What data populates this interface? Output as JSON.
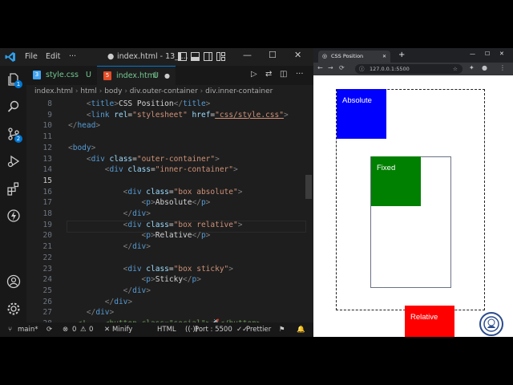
{
  "window": {
    "title": "index.html - 13_l...",
    "menu": [
      "File",
      "Edit",
      "···"
    ]
  },
  "tabs": [
    {
      "label": "style.css",
      "status": "U"
    },
    {
      "label": "index.html",
      "status": "U"
    }
  ],
  "breadcrumb": [
    "index.html",
    "html",
    "body",
    "div.outer-container",
    "div.inner-container"
  ],
  "activity_badges": [
    "1",
    "2"
  ],
  "editor": {
    "line_numbers": [
      "8",
      "9",
      "10",
      "11",
      "12",
      "13",
      "14",
      "15",
      "16",
      "17",
      "18",
      "19",
      "20",
      "21",
      "22",
      "23",
      "24",
      "25",
      "26",
      "27",
      "28"
    ],
    "lines": [
      "    <title>CSS Position</title>",
      "    <link rel=\"stylesheet\" href=\"css/style.css\">",
      "</head>",
      "",
      "<body>",
      "    <div class=\"outer-container\">",
      "        <div class=\"inner-container\">",
      "",
      "            <div class=\"box absolute\">",
      "                <p>Absolute</p>",
      "            </div>",
      "            <div class=\"box relative\">",
      "                <p>Relative</p>",
      "            </div>",
      "",
      "            <div class=\"box sticky\">",
      "                <p>Sticky</p>",
      "            </div>",
      "        </div>",
      "    </div>",
      "  <!--  <button class=\"social\">🚀</button>"
    ],
    "current_line": "15"
  },
  "statusbar": {
    "branch": "main*",
    "errors": "0",
    "warnings": "0",
    "minify": "Minify",
    "language": "HTML",
    "port": "Port : 5500",
    "prettier": "Prettier"
  },
  "browser": {
    "tab_title": "CSS Position",
    "address": "127.0.0.1:5500",
    "boxes": {
      "absolute": "Absolute",
      "fixed": "Fixed",
      "relative": "Relative"
    }
  },
  "colors": {
    "editor_bg": "#1e1e1e",
    "accent": "#0078d4",
    "blue": "#0000ff",
    "green": "#008000",
    "red": "#ff0000"
  }
}
